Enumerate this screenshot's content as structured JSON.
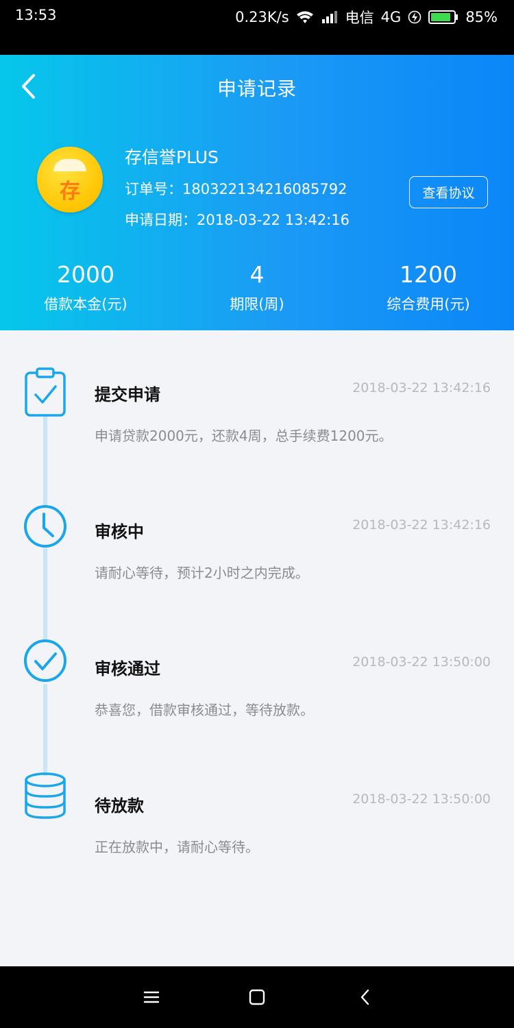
{
  "status_bar": {
    "time": "13:53",
    "speed": "0.23K/s",
    "carrier": "电信",
    "network": "4G",
    "battery": "85%"
  },
  "header": {
    "title": "申请记录",
    "back_icon": "chevron-left-icon",
    "product_name": "存信誉PLUS",
    "logo_char": "存",
    "order_label": "订单号：",
    "order_no": "180322134216085792",
    "date_label": "申请日期：",
    "date": "2018-03-22 13:42:16",
    "agreement_button": "查看协议",
    "stats": [
      {
        "value": "2000",
        "label": "借款本金(元)"
      },
      {
        "value": "4",
        "label": "期限(周)"
      },
      {
        "value": "1200",
        "label": "综合费用(元)"
      }
    ]
  },
  "timeline": {
    "steps": [
      {
        "name": "提交申请",
        "time": "2018-03-22 13:42:16",
        "desc": "申请贷款2000元，还款4周，总手续费1200元。",
        "icon": "clipboard-check-icon"
      },
      {
        "name": "审核中",
        "time": "2018-03-22 13:42:16",
        "desc": "请耐心等待，预计2小时之内完成。",
        "icon": "clock-icon"
      },
      {
        "name": "审核通过",
        "time": "2018-03-22 13:50:00",
        "desc": "恭喜您，借款审核通过，等待放款。",
        "icon": "check-circle-icon"
      },
      {
        "name": "待放款",
        "time": "2018-03-22 13:50:00",
        "desc": "正在放款中，请耐心等待。",
        "icon": "database-icon"
      }
    ],
    "accent_color": "#1aa6ea",
    "line_color": "#c9e6f7"
  },
  "nav_bar": {
    "menu_icon": "menu-icon",
    "home_icon": "home-square-icon",
    "back_icon": "back-triangle-icon"
  }
}
